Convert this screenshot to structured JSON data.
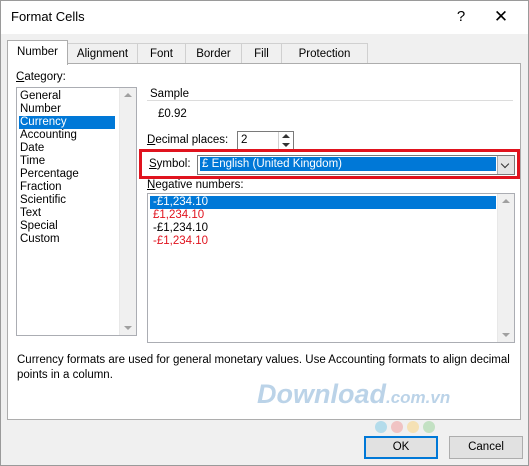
{
  "window": {
    "title": "Format Cells",
    "help_glyph": "?",
    "close_glyph": "✕"
  },
  "tabs": [
    {
      "label": "Number",
      "active": true
    },
    {
      "label": "Alignment",
      "active": false
    },
    {
      "label": "Font",
      "active": false
    },
    {
      "label": "Border",
      "active": false
    },
    {
      "label": "Fill",
      "active": false
    },
    {
      "label": "Protection",
      "active": false
    }
  ],
  "category": {
    "label_key": "C",
    "label_rest": "ategory:",
    "items": [
      "General",
      "Number",
      "Currency",
      "Accounting",
      "Date",
      "Time",
      "Percentage",
      "Fraction",
      "Scientific",
      "Text",
      "Special",
      "Custom"
    ],
    "selected": "Currency"
  },
  "sample": {
    "label": "Sample",
    "value": "£0.92"
  },
  "decimal": {
    "label_key": "D",
    "label_rest": "ecimal places:",
    "value": "2"
  },
  "symbol": {
    "label_key": "S",
    "label_rest": "ymbol:",
    "value": "£ English (United Kingdom)"
  },
  "negative": {
    "label_key": "N",
    "label_rest": "egative numbers:",
    "items": [
      {
        "text": "-£1,234.10",
        "color": "#000000",
        "selected": true
      },
      {
        "text": "£1,234.10",
        "color": "#e0131e",
        "selected": false
      },
      {
        "text": "-£1,234.10",
        "color": "#000000",
        "selected": false
      },
      {
        "text": "-£1,234.10",
        "color": "#e0131e",
        "selected": false
      }
    ]
  },
  "description": "Currency formats are used for general monetary values.  Use Accounting formats to align decimal points in a column.",
  "watermark": {
    "main": "Download",
    "suffix": ".com.vn"
  },
  "buttons": {
    "ok": "OK",
    "cancel": "Cancel"
  },
  "colors": {
    "accent": "#0078d7",
    "highlight": "#e0131e",
    "negative_red": "#e0131e"
  }
}
